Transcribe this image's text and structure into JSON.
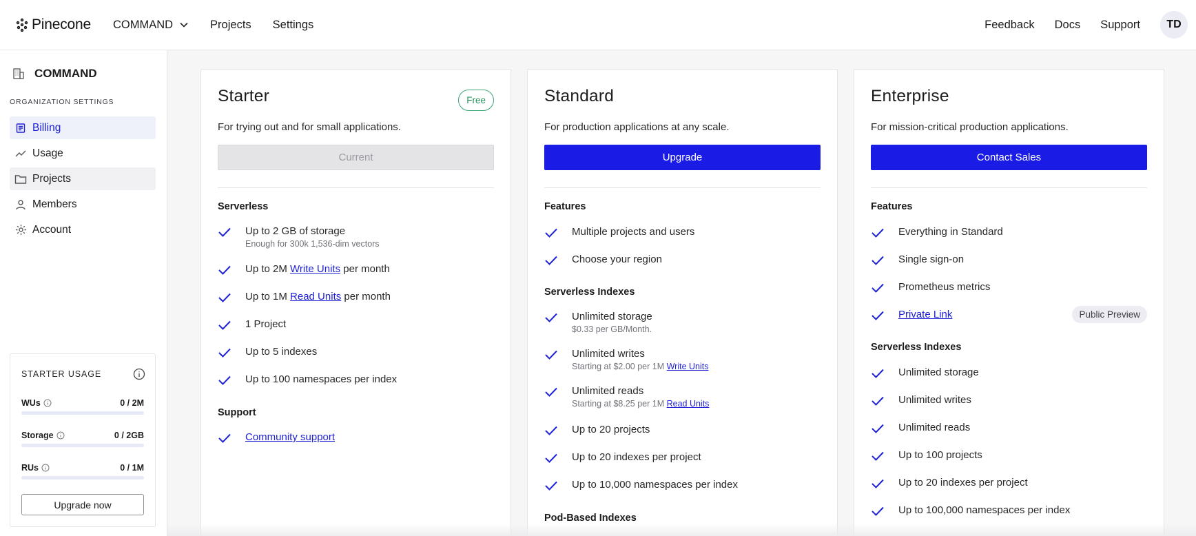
{
  "header": {
    "brand": "Pinecone",
    "org_name": "COMMAND",
    "nav": [
      "Projects",
      "Settings"
    ],
    "right_links": [
      "Feedback",
      "Docs",
      "Support"
    ],
    "avatar_initials": "TD"
  },
  "sidebar": {
    "org_name": "COMMAND",
    "section_label": "ORGANIZATION SETTINGS",
    "items": [
      {
        "label": "Billing",
        "icon": "chart-bar-icon",
        "state": "active"
      },
      {
        "label": "Usage",
        "icon": "trend-line-icon",
        "state": ""
      },
      {
        "label": "Projects",
        "icon": "folder-icon",
        "state": "hover"
      },
      {
        "label": "Members",
        "icon": "user-icon",
        "state": ""
      },
      {
        "label": "Account",
        "icon": "gear-icon",
        "state": ""
      }
    ],
    "usage": {
      "title": "STARTER USAGE",
      "rows": [
        {
          "label": "WUs",
          "value": "0 / 2M",
          "fraction": 0
        },
        {
          "label": "Storage",
          "value": "0 / 2GB",
          "fraction": 0
        },
        {
          "label": "RUs",
          "value": "0 / 1M",
          "fraction": 0
        }
      ],
      "button": "Upgrade now"
    }
  },
  "plans": {
    "starter": {
      "title": "Starter",
      "badge": "Free",
      "description": "For trying out and for small applications.",
      "cta": "Current",
      "sections": [
        {
          "heading": "Serverless",
          "features": [
            {
              "pre": "Up to 2 GB of storage",
              "sub": "Enough for 300k 1,536-dim vectors"
            },
            {
              "pre": "Up to 2M ",
              "link": "Write Units",
              "post": " per month"
            },
            {
              "pre": "Up to 1M ",
              "link": "Read Units",
              "post": " per month"
            },
            {
              "pre": "1 Project"
            },
            {
              "pre": "Up to 5 indexes"
            },
            {
              "pre": "Up to 100 namespaces per index"
            }
          ]
        },
        {
          "heading": "Support",
          "features": [
            {
              "link": "Community support"
            }
          ]
        }
      ]
    },
    "standard": {
      "title": "Standard",
      "description": "For production applications at any scale.",
      "cta": "Upgrade",
      "sections": [
        {
          "heading": "Features",
          "features": [
            {
              "pre": "Multiple projects and users"
            },
            {
              "pre": "Choose your region"
            }
          ]
        },
        {
          "heading": "Serverless Indexes",
          "features": [
            {
              "pre": "Unlimited storage",
              "sub": "$0.33 per GB/Month."
            },
            {
              "pre": "Unlimited writes",
              "sub": "Starting at $2.00 per 1M ",
              "sub_link": "Write Units"
            },
            {
              "pre": "Unlimited reads",
              "sub": "Starting at $8.25 per 1M ",
              "sub_link": "Read Units"
            },
            {
              "pre": "Up to 20 projects"
            },
            {
              "pre": "Up to 20 indexes per project"
            },
            {
              "pre": "Up to 10,000 namespaces per index"
            }
          ]
        },
        {
          "heading": "Pod-Based Indexes",
          "features": []
        }
      ]
    },
    "enterprise": {
      "title": "Enterprise",
      "description": "For mission-critical production applications.",
      "cta": "Contact Sales",
      "sections": [
        {
          "heading": "Features",
          "features": [
            {
              "pre": "Everything in Standard"
            },
            {
              "pre": "Single sign-on"
            },
            {
              "pre": "Prometheus metrics"
            },
            {
              "link": "Private Link",
              "pill": "Public Preview"
            }
          ]
        },
        {
          "heading": "Serverless Indexes",
          "features": [
            {
              "pre": "Unlimited storage"
            },
            {
              "pre": "Unlimited writes"
            },
            {
              "pre": "Unlimited reads"
            },
            {
              "pre": "Up to 100 projects"
            },
            {
              "pre": "Up to 20 indexes per project"
            },
            {
              "pre": "Up to 100,000 namespaces per index"
            }
          ]
        }
      ]
    }
  },
  "colors": {
    "accent": "#1a1ce6",
    "badge_green": "#26925f",
    "check": "#1e21d6"
  }
}
